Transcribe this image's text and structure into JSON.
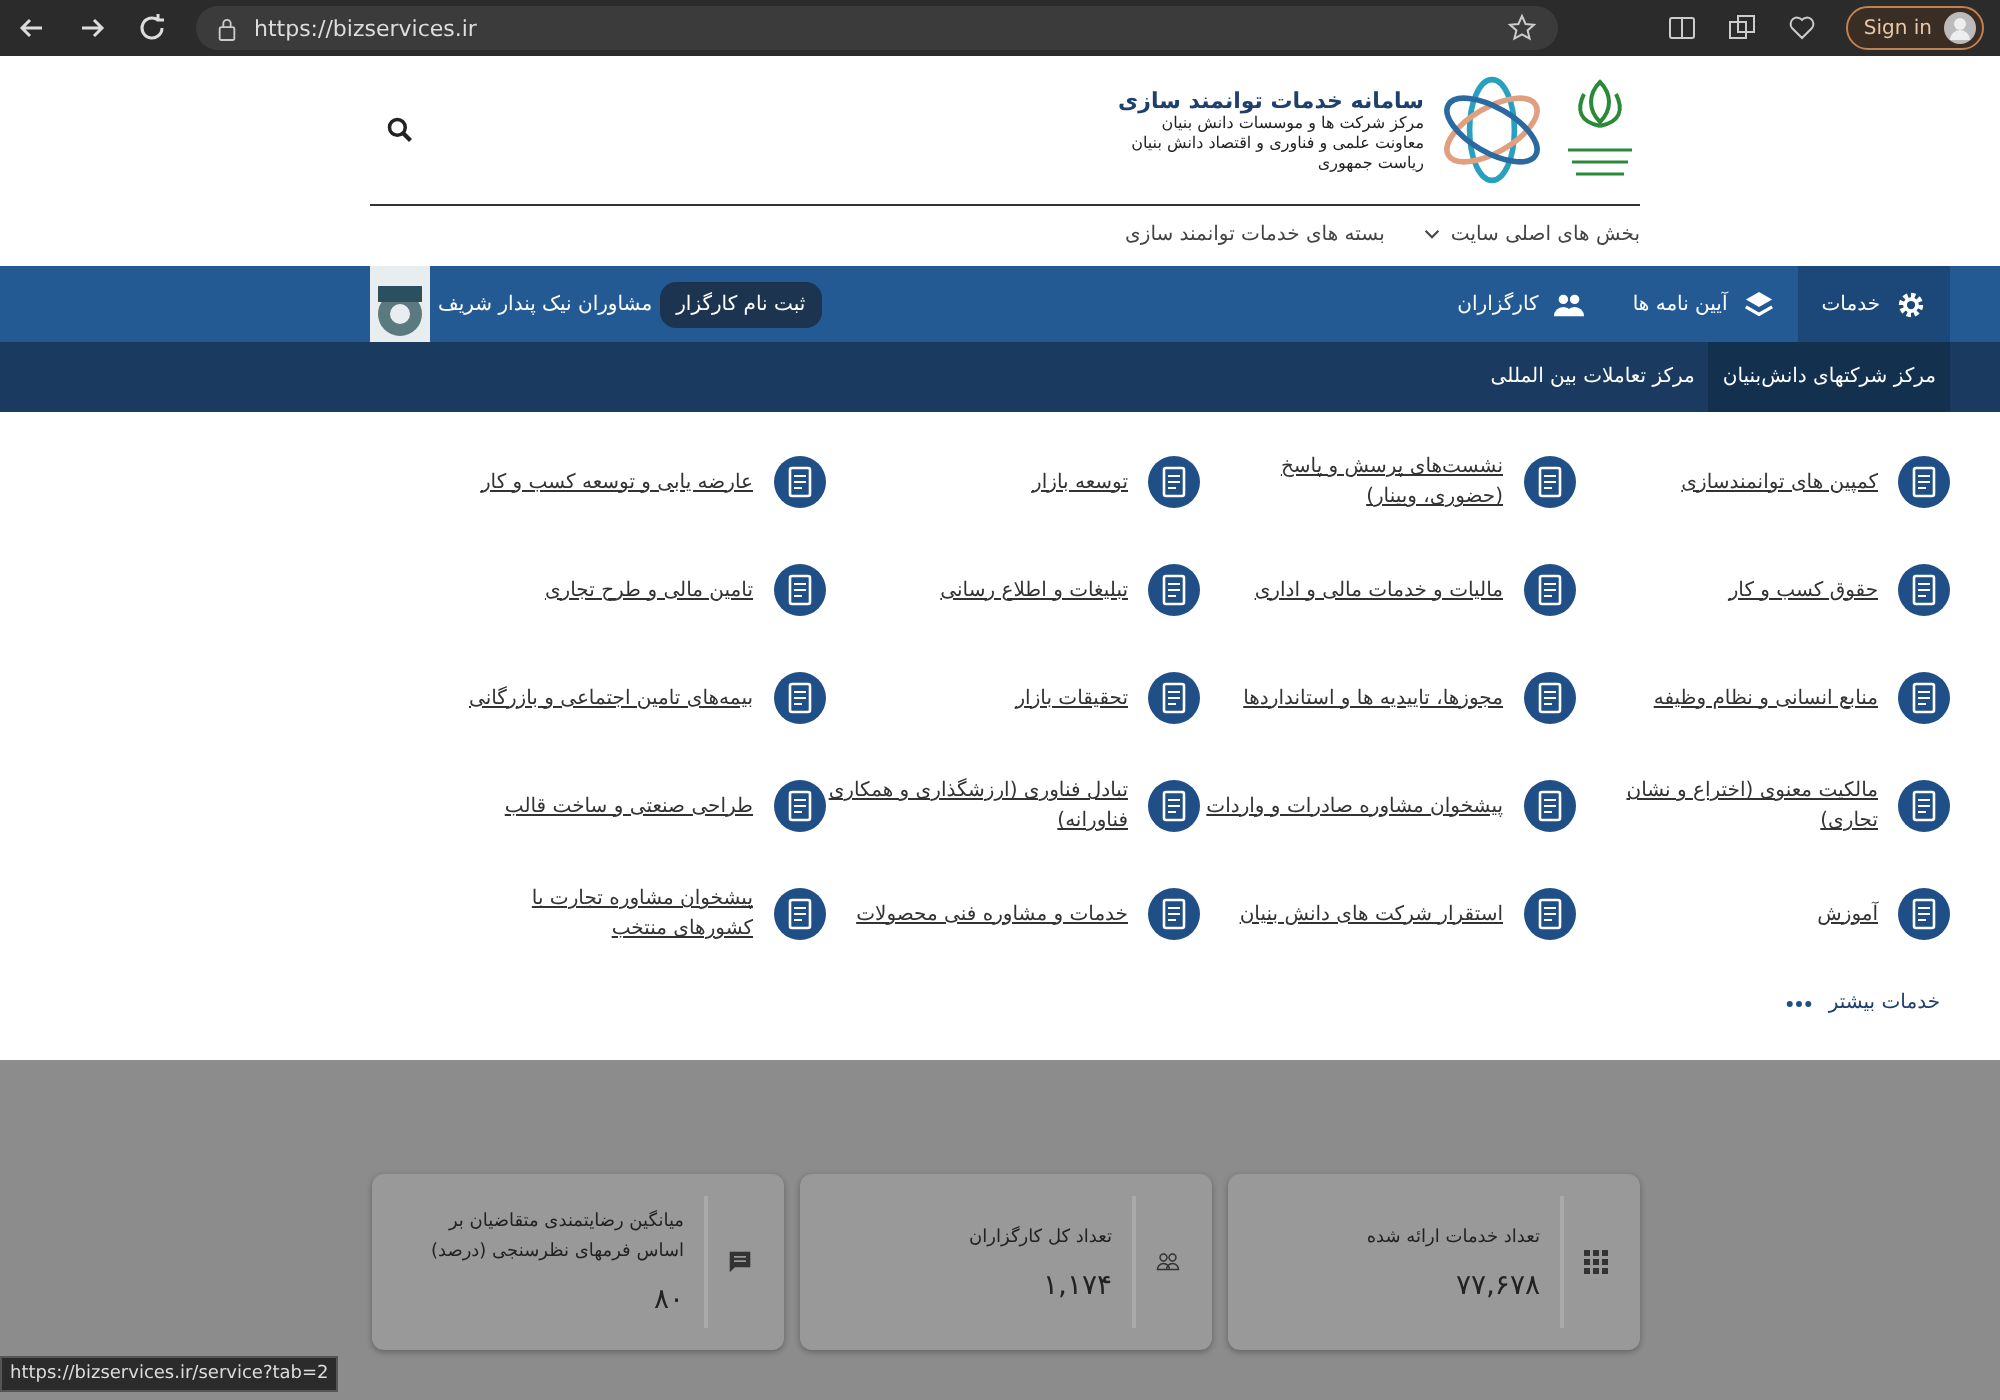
{
  "browser": {
    "url": "https://bizservices.ir",
    "sign_in": "Sign in"
  },
  "header": {
    "title": "سامانه خدمات توانمند سازی",
    "subtitle_lines": [
      "مرکز شرکت ها و موسسات دانش بنیان",
      "معاونت علمی و فناوری و اقتصاد دانش بنیان",
      "ریاست جمهوری"
    ]
  },
  "secondary_nav": [
    {
      "label": "بخش های اصلی سایت",
      "dropdown": true
    },
    {
      "label": "بسته های خدمات توانمند سازی",
      "dropdown": false
    }
  ],
  "main_nav": {
    "items": [
      {
        "label": "خدمات",
        "kind": "gear",
        "selected": true
      },
      {
        "label": "آیین نامه ها",
        "kind": "layers",
        "selected": false
      },
      {
        "label": "کارگزاران",
        "kind": "people",
        "selected": false
      }
    ],
    "register_button": "ثبت نام کارگزار",
    "broker_name": "مشاوران نیک پندار شریف"
  },
  "sub_tabs": [
    {
      "label": "مرکز شرکتهای دانش‌بنیان",
      "selected": true
    },
    {
      "label": "مرکز تعاملات بین المللی",
      "selected": false
    }
  ],
  "services": [
    {
      "label": "کمپین های توانمندسازی"
    },
    {
      "label": "نشست‌های پرسش و پاسخ (حضوری، وبینار)"
    },
    {
      "label": "توسعه بازار"
    },
    {
      "label": "عارضه یابی و توسعه کسب و کار"
    },
    {
      "label": "حقوق کسب و کار"
    },
    {
      "label": "مالیات و خدمات مالی و اداری"
    },
    {
      "label": "تبلیغات و اطلاع رسانی"
    },
    {
      "label": "تامین مالی و طرح تجاری"
    },
    {
      "label": "منابع انسانی و نظام وظیفه"
    },
    {
      "label": "مجوزها، تاییدیه ها و استانداردها"
    },
    {
      "label": "تحقیقات بازار"
    },
    {
      "label": "بیمه‌های تامین اجتماعی و بازرگانی"
    },
    {
      "label": "مالکیت معنوی (اختراع و نشان تجاری)"
    },
    {
      "label": "پیشخوان مشاوره صادرات و واردات"
    },
    {
      "label": "تبادل فناوری (ارزشگذاری و همکاری فناورانه)"
    },
    {
      "label": "طراحی صنعتی و ساخت قالب"
    },
    {
      "label": "آموزش"
    },
    {
      "label": "استقرار شرکت های دانش بنیان"
    },
    {
      "label": "خدمات و مشاوره فنی محصولات"
    },
    {
      "label": "پیشخوان مشاوره تجارت با کشورهای منتخب"
    }
  ],
  "more_services": "خدمات بیشتر",
  "stats": [
    {
      "label": "تعداد خدمات ارائه شده",
      "value": "۷۷,۶۷۸",
      "kind": "grid"
    },
    {
      "label": "تعداد کل کارگزاران",
      "value": "۱,۱۷۴",
      "kind": "people"
    },
    {
      "label": "میانگین رضایتمندی متقاضیان بر اساس فرمهای نظرسنجی (درصد)",
      "value": "۸۰",
      "kind": "comment"
    }
  ],
  "status_url": "https://bizservices.ir/service?tab=2"
}
